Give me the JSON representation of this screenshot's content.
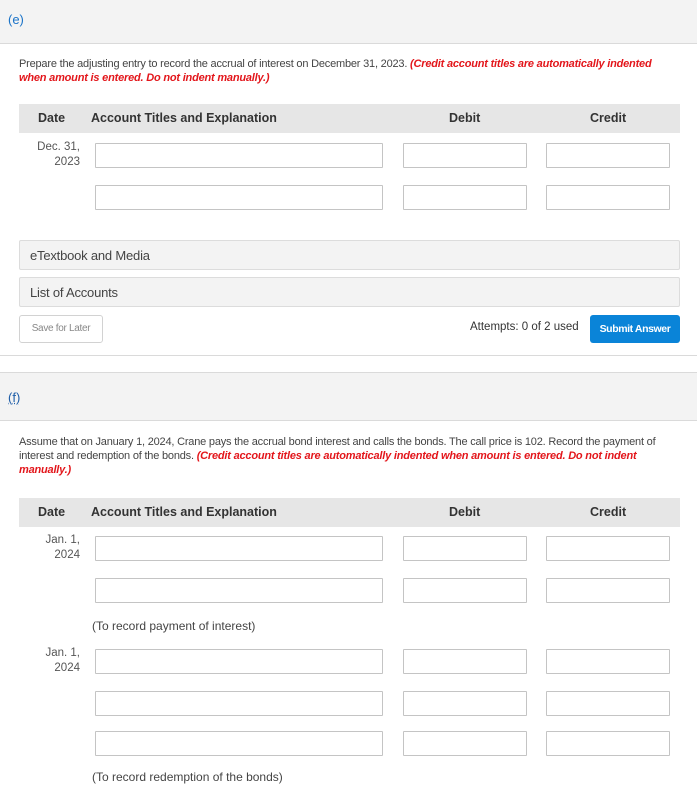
{
  "part_e": {
    "label": "(e)",
    "question": "Prepare the adjusting entry to record the accrual of interest on December 31, 2023. ",
    "hint": "(Credit account titles are automatically indented when amount is entered. Do not indent manually.)",
    "table_headers": {
      "date": "Date",
      "account": "Account Titles and Explanation",
      "debit": "Debit",
      "credit": "Credit"
    },
    "entries": [
      {
        "date_line1": "Dec. 31,",
        "date_line2": "2023",
        "rows": [
          {
            "account": "",
            "debit": "",
            "credit": ""
          },
          {
            "account": "",
            "debit": "",
            "credit": ""
          }
        ]
      }
    ],
    "etextbook_label": "eTextbook and Media",
    "list_of_accounts_label": "List of Accounts",
    "save_label": "Save for Later",
    "attempts_text": "Attempts: 0 of 2 used",
    "submit_label": "Submit Answer"
  },
  "part_f": {
    "label": "(f)",
    "question": "Assume that on January 1, 2024, Crane pays the accrual bond interest and calls the bonds. The call price is 102. Record the payment of interest and redemption of the bonds. ",
    "hint": "(Credit account titles are automatically indented when amount is entered. Do not indent manually.)",
    "table_headers": {
      "date": "Date",
      "account": "Account Titles and Explanation",
      "debit": "Debit",
      "credit": "Credit"
    },
    "entries": [
      {
        "date_line1": "Jan. 1,",
        "date_line2": "2024",
        "note": "(To record payment of interest)"
      },
      {
        "date_line1": "Jan. 1,",
        "date_line2": "2024",
        "note": "(To record redemption of the bonds)"
      }
    ]
  },
  "colors": {
    "link": "#1a73c8",
    "hint_red": "#e3161b",
    "submit_blue": "#0a84d8"
  }
}
